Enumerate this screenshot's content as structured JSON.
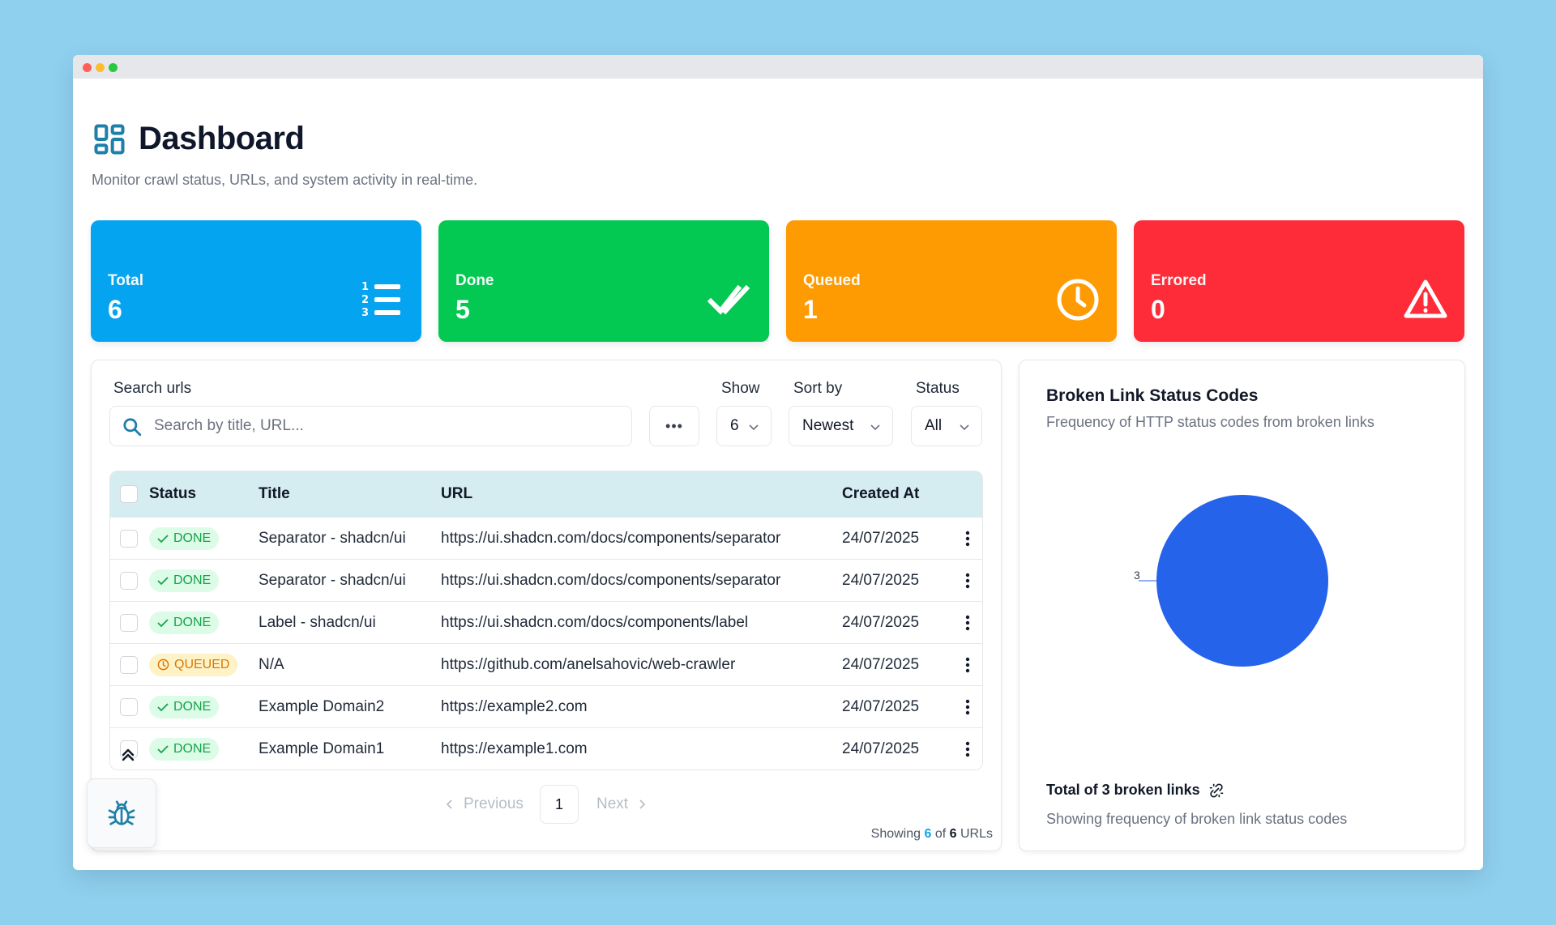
{
  "header": {
    "title": "Dashboard",
    "subtitle": "Monitor crawl status, URLs, and system activity in real-time."
  },
  "stats": [
    {
      "label": "Total",
      "value": "6",
      "color": "#05a4f0",
      "icon": "numbered-list-icon"
    },
    {
      "label": "Done",
      "value": "5",
      "color": "#03c852",
      "icon": "double-check-icon"
    },
    {
      "label": "Queued",
      "value": "1",
      "color": "#fe9b02",
      "icon": "clock-icon"
    },
    {
      "label": "Errored",
      "value": "0",
      "color": "#fe2b38",
      "icon": "warning-icon"
    }
  ],
  "controls": {
    "search_label": "Search urls",
    "search_placeholder": "Search by title, URL...",
    "more_label": "•••",
    "show_label": "Show",
    "show_value": "6",
    "sort_label": "Sort by",
    "sort_value": "Newest",
    "status_label": "Status",
    "status_value": "All"
  },
  "table": {
    "columns": [
      "Status",
      "Title",
      "URL",
      "Created At"
    ],
    "rows": [
      {
        "status": "DONE",
        "title": "Separator - shadcn/ui",
        "url": "https://ui.shadcn.com/docs/components/separator",
        "created": "24/07/2025"
      },
      {
        "status": "DONE",
        "title": "Separator - shadcn/ui",
        "url": "https://ui.shadcn.com/docs/components/separator",
        "created": "24/07/2025"
      },
      {
        "status": "DONE",
        "title": "Label - shadcn/ui",
        "url": "https://ui.shadcn.com/docs/components/label",
        "created": "24/07/2025"
      },
      {
        "status": "QUEUED",
        "title": "N/A",
        "url": "https://github.com/anelsahovic/web-crawler",
        "created": "24/07/2025"
      },
      {
        "status": "DONE",
        "title": "Example Domain2",
        "url": "https://example2.com",
        "created": "24/07/2025"
      },
      {
        "status": "DONE",
        "title": "Example Domain1",
        "url": "https://example1.com",
        "created": "24/07/2025"
      }
    ]
  },
  "pagination": {
    "prev_label": "Previous",
    "page": "1",
    "next_label": "Next",
    "showing_prefix": "Showing",
    "showing_count": "6",
    "showing_of": "of",
    "showing_total": "6",
    "showing_suffix": "URLs"
  },
  "chart_panel": {
    "title": "Broken Link Status Codes",
    "description": "Frequency of HTTP status codes from broken links",
    "footer_title": "Total of 3 broken links",
    "footer_desc": "Showing frequency of broken link status codes"
  },
  "chart_data": {
    "type": "pie",
    "slices": [
      {
        "value": 3,
        "color": "#2563eb"
      }
    ],
    "data_labels": [
      "3"
    ]
  }
}
